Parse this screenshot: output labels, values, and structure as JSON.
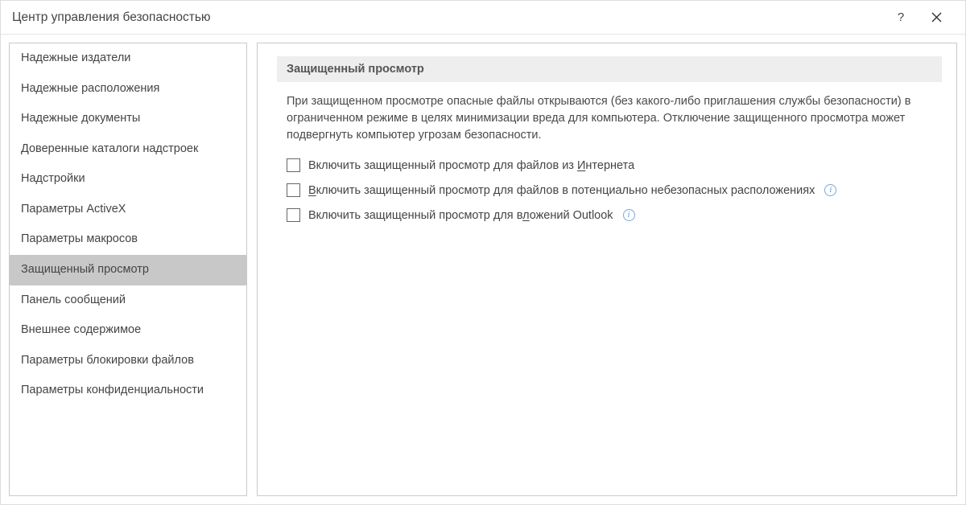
{
  "titlebar": {
    "title": "Центр управления безопасностью",
    "help_label": "?",
    "close_label": "×"
  },
  "sidebar": {
    "items": [
      {
        "label": "Надежные издатели",
        "selected": false
      },
      {
        "label": "Надежные расположения",
        "selected": false
      },
      {
        "label": "Надежные документы",
        "selected": false
      },
      {
        "label": "Доверенные каталоги надстроек",
        "selected": false
      },
      {
        "label": "Надстройки",
        "selected": false
      },
      {
        "label": "Параметры ActiveX",
        "selected": false
      },
      {
        "label": "Параметры макросов",
        "selected": false
      },
      {
        "label": "Защищенный просмотр",
        "selected": true
      },
      {
        "label": "Панель сообщений",
        "selected": false
      },
      {
        "label": "Внешнее содержимое",
        "selected": false
      },
      {
        "label": "Параметры блокировки файлов",
        "selected": false
      },
      {
        "label": "Параметры конфиденциальности",
        "selected": false
      }
    ]
  },
  "main": {
    "section_title": "Защищенный просмотр",
    "description": "При защищенном просмотре опасные файлы открываются (без какого-либо приглашения службы безопасности) в ограниченном режиме в целях минимизации вреда для компьютера. Отключение защищенного просмотра может подвергнуть компьютер угрозам безопасности.",
    "options": [
      {
        "checked": false,
        "pre": "Включить защищенный просмотр для файлов из ",
        "u": "И",
        "post": "нтернета",
        "info": false
      },
      {
        "checked": false,
        "pre": "",
        "u": "В",
        "post": "ключить защищенный просмотр для файлов в потенциально небезопасных расположениях",
        "info": true
      },
      {
        "checked": false,
        "pre": "Включить защищенный просмотр для в",
        "u": "л",
        "post": "ожений Outlook",
        "info": true
      }
    ],
    "info_glyph": "i"
  }
}
